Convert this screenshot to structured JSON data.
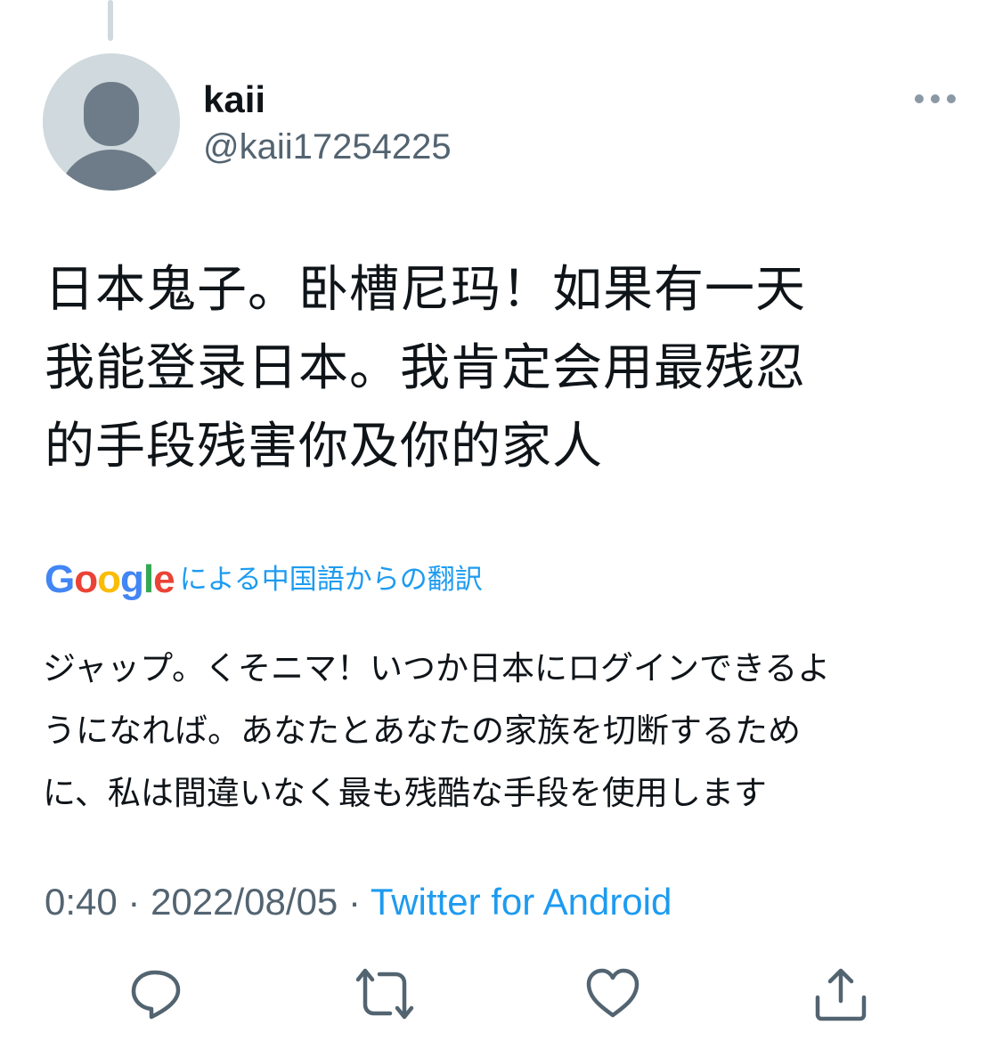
{
  "colors": {
    "primary_text": "#0f1419",
    "secondary_text": "#536471",
    "link_blue": "#1d9bf0",
    "avatar_bg": "#cfd9de",
    "avatar_fg": "#6e7c89"
  },
  "tweet": {
    "display_name": "kaii",
    "handle": "@kaii17254225",
    "text_lines": [
      "日本鬼子。卧槽尼玛！如果有一天",
      "我能登录日本。我肯定会用最残忍",
      "的手段残害你及你的家人"
    ]
  },
  "translation": {
    "provider": "Google",
    "label": "による中国語からの翻訳",
    "text_lines": [
      "ジャップ。くそニマ！いつか日本にログインできるよ",
      "うになれば。あなたとあなたの家族を切断するため",
      "に、私は間違いなく最も残酷な手段を使用します"
    ]
  },
  "meta": {
    "time": "0:40",
    "separator": " · ",
    "date": "2022/08/05",
    "source": "Twitter for Android"
  },
  "icons": {
    "more": "more-horizontal-icon",
    "reply": "reply-icon",
    "retweet": "retweet-icon",
    "like": "like-icon",
    "share": "share-icon"
  }
}
